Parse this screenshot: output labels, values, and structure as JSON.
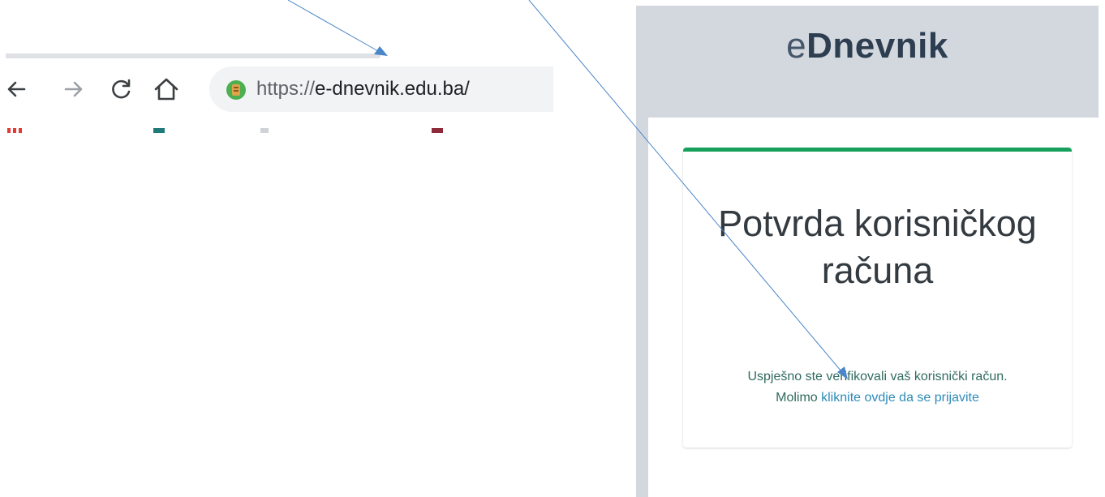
{
  "browser": {
    "url_scheme": "https://",
    "url_host": "e-dnevnik.edu.ba/",
    "nav": {
      "back_icon": "back-arrow-icon",
      "forward_icon": "forward-arrow-icon",
      "reload_icon": "reload-icon",
      "home_icon": "home-icon"
    }
  },
  "page": {
    "brand_prefix": "e",
    "brand_main": "Dnevnik",
    "card": {
      "title": "Potvrda korisničkog računa",
      "message_line1": "Uspješno ste verifikovali vaš korisnički račun.",
      "message_line2_prefix": "Molimo ",
      "login_link": "kliknite ovdje da se prijavite"
    }
  },
  "colors": {
    "accent_green": "#16a05c",
    "link_blue": "#2d8bb9",
    "arrow_blue": "#4a86c8",
    "panel_gray": "#d3d8df"
  }
}
